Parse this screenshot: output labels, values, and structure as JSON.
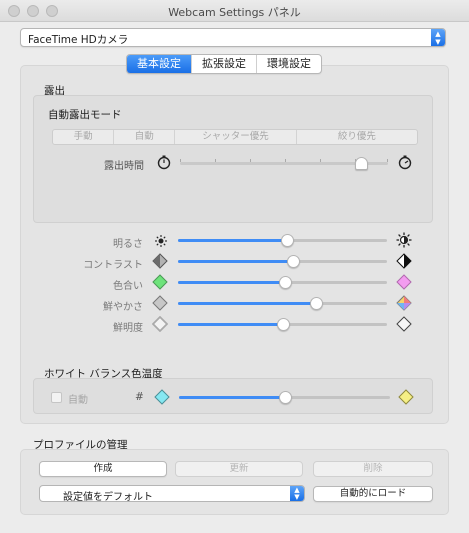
{
  "window": {
    "title": "Webcam Settings パネル"
  },
  "device": {
    "selected": "FaceTime HDカメラ"
  },
  "tabs": [
    "基本設定",
    "拡張設定",
    "環境設定"
  ],
  "exposure": {
    "section_title": "露出",
    "mode_title": "自動露出モード",
    "modes": [
      "手動",
      "自動",
      "シャッター優先",
      "絞り優先"
    ],
    "time_label": "露出時間",
    "time_value": 0.87
  },
  "adjustments": [
    {
      "label": "明るさ",
      "value": 0.52
    },
    {
      "label": "コントラスト",
      "value": 0.55
    },
    {
      "label": "色合い",
      "value": 0.51
    },
    {
      "label": "鮮やかさ",
      "value": 0.66
    },
    {
      "label": "鮮明度",
      "value": 0.5
    }
  ],
  "white_balance": {
    "title": "ホワイト バランス色温度",
    "auto_label": "自動",
    "hash_label": "#",
    "value": 0.5
  },
  "profiles": {
    "title": "プロファイルの管理",
    "create": "作成",
    "update": "更新",
    "delete": "削除",
    "preset": "設定値をデフォルト",
    "autoload": "自動的にロード"
  },
  "colors": {
    "accent": "#3f8cf5",
    "tab_active": "#1a6fe6"
  }
}
